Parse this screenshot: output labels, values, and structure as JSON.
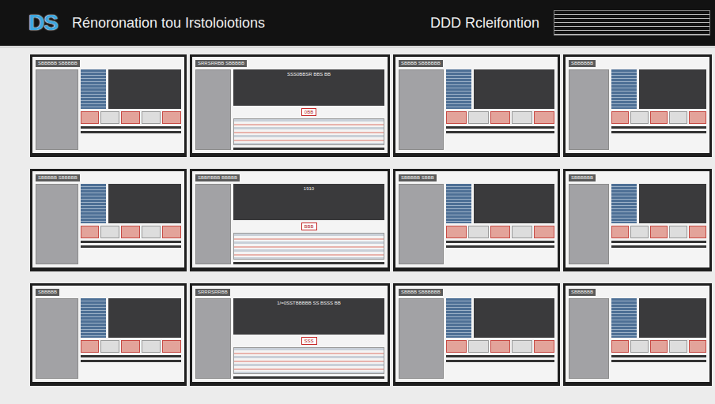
{
  "header": {
    "logo": "DS",
    "title": "Rénoronation tou Irstoloiotions",
    "subtitle": "DDD Rcleifontion"
  },
  "thumbnails": [
    {
      "kind": "narrow",
      "label": "SBBBBB SBBBBB"
    },
    {
      "kind": "wide",
      "label": "SRRSRRBB SBBBBB",
      "screen_text": "SSS0BBSR BBS BB",
      "badge": "0BB"
    },
    {
      "kind": "narrow",
      "label": "SBBBB SBBBBBB"
    },
    {
      "kind": "narrow",
      "label": "SBBBBBB"
    },
    {
      "kind": "narrow",
      "label": "SBBBBB SBBBBB"
    },
    {
      "kind": "wide",
      "label": "SBBRBBB BBBBB",
      "screen_text": "1910",
      "badge": "BBB"
    },
    {
      "kind": "narrow",
      "label": "SBBBBB SBBB"
    },
    {
      "kind": "narrow",
      "label": "SBBBBBB"
    },
    {
      "kind": "narrow",
      "label": "SBBBBB"
    },
    {
      "kind": "wide",
      "label": "SRRRSRRBB",
      "screen_text": "1/=0SSTBBBBB SS BSSS BB",
      "badge": "SSS"
    },
    {
      "kind": "narrow",
      "label": "SBBBB SBBBBBB"
    },
    {
      "kind": "narrow",
      "label": "SBBBBBB"
    }
  ]
}
